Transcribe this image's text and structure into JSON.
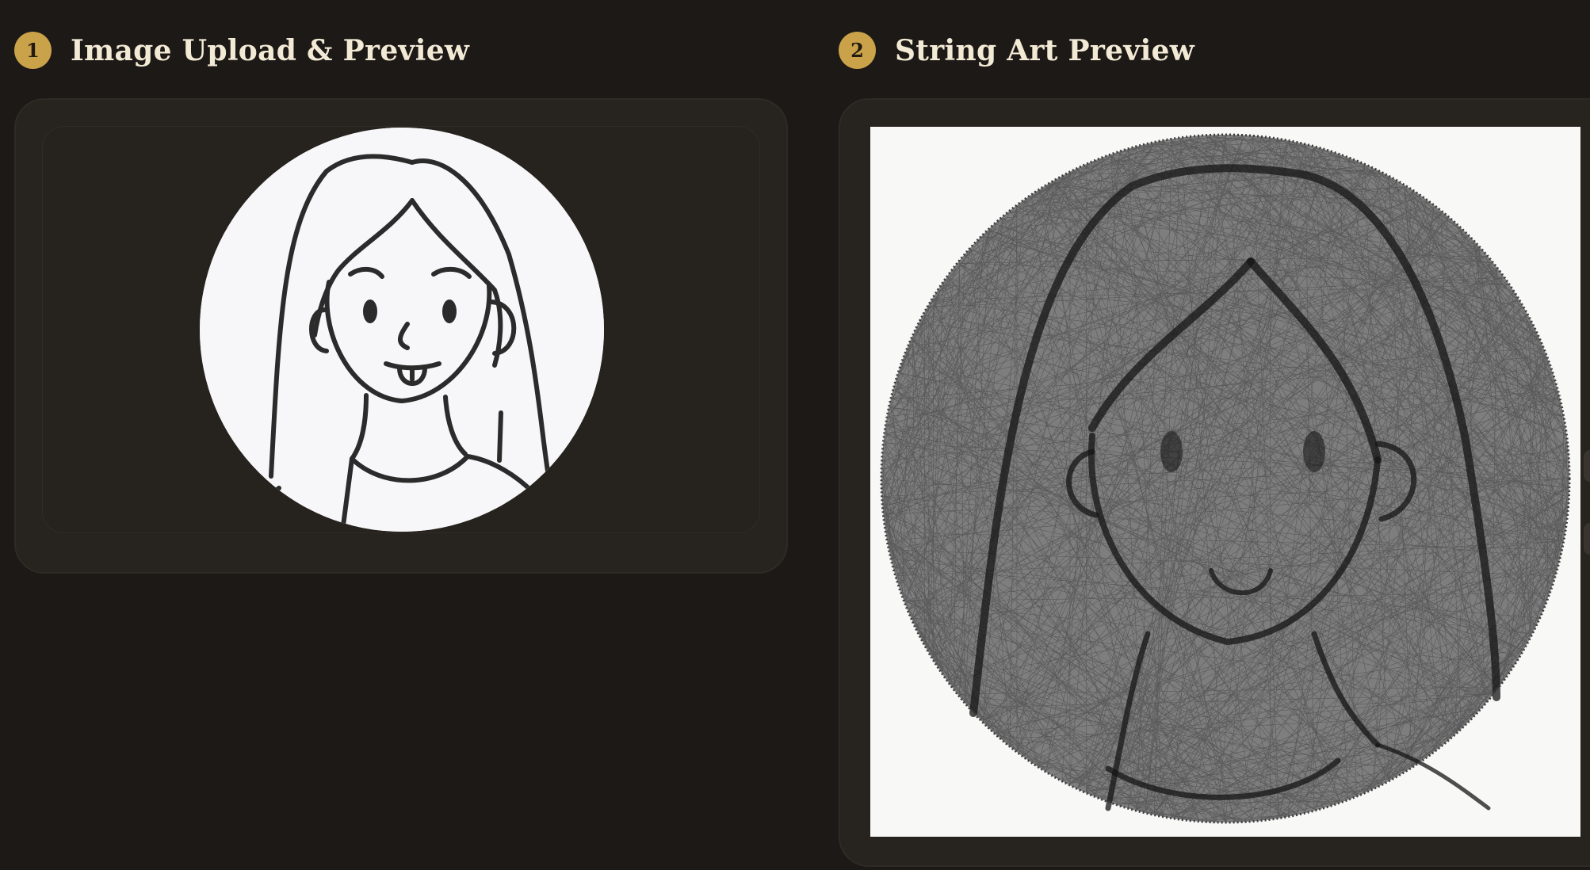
{
  "sections": [
    {
      "step": "1",
      "title": "Image Upload & Preview"
    },
    {
      "step": "2",
      "title": "String Art Preview"
    }
  ],
  "colors": {
    "background": "#1d1916",
    "card": "#27231f",
    "accent": "#c9a24a",
    "title_text": "#f3ead6"
  }
}
